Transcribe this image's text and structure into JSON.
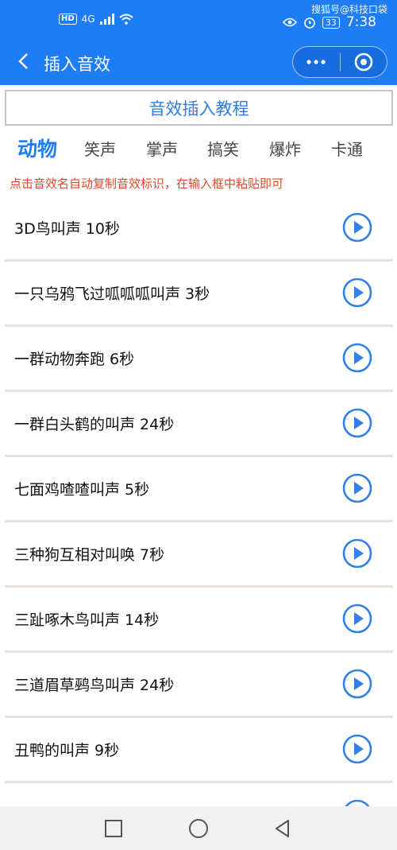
{
  "status_bar": {
    "network": "4G",
    "badge_hd": "HD",
    "battery": "33",
    "time": "7:38",
    "watermark": "搜狐号@科技口袋"
  },
  "nav": {
    "title": "插入音效"
  },
  "tutorial_button": "音效插入教程",
  "tabs": [
    {
      "label": "动物",
      "active": true
    },
    {
      "label": "笑声",
      "active": false
    },
    {
      "label": "掌声",
      "active": false
    },
    {
      "label": "搞笑",
      "active": false
    },
    {
      "label": "爆炸",
      "active": false
    },
    {
      "label": "卡通",
      "active": false
    }
  ],
  "hint": "点击音效名自动复制音效标识，在输入框中粘贴即可",
  "sounds": [
    {
      "name": "3D鸟叫声 10秒"
    },
    {
      "name": "一只乌鸦飞过呱呱呱叫声 3秒"
    },
    {
      "name": "一群动物奔跑 6秒"
    },
    {
      "name": "一群白头鹤的叫声 24秒"
    },
    {
      "name": "七面鸡喳喳叫声 5秒"
    },
    {
      "name": "三种狗互相对叫唤 7秒"
    },
    {
      "name": "三趾啄木鸟叫声 14秒"
    },
    {
      "name": "三道眉草鹀鸟叫声 24秒"
    },
    {
      "name": "丑鸭的叫声 9秒"
    },
    {
      "name": ""
    }
  ],
  "colors": {
    "accent": "#1e7df5",
    "hint": "#e0482a",
    "play_icon": "#2f80e8"
  }
}
